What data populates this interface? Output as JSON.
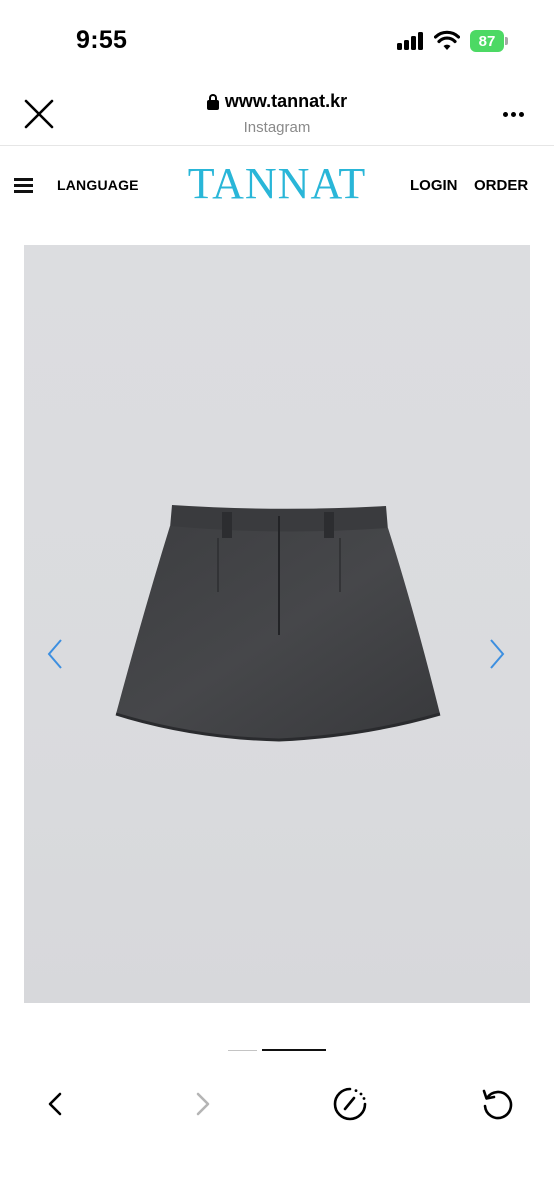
{
  "status_bar": {
    "time": "9:55",
    "battery_level": "87",
    "icons": [
      "signal-icon",
      "wifi-icon",
      "battery-icon"
    ]
  },
  "browser": {
    "url": "www.tannat.kr",
    "source": "Instagram",
    "icons": [
      "close-icon",
      "lock-icon",
      "more-icon"
    ]
  },
  "site_nav": {
    "menu_icon": "hamburger-icon",
    "language_label": "LANGUAGE",
    "logo_text": "TANNAT",
    "login_label": "LOGIN",
    "order_label": "ORDER",
    "logo_color": "#29b6d8"
  },
  "product_gallery": {
    "image": "charcoal-mini-skirt-back-view",
    "prev_icon": "chevron-left-icon",
    "next_icon": "chevron-right-icon",
    "arrow_color": "#3d8fe0",
    "total_slides": 2,
    "active_slide": 2
  },
  "toolbar": {
    "icons": [
      "back-icon",
      "forward-icon",
      "speed-icon",
      "reload-icon"
    ],
    "forward_enabled": false
  }
}
